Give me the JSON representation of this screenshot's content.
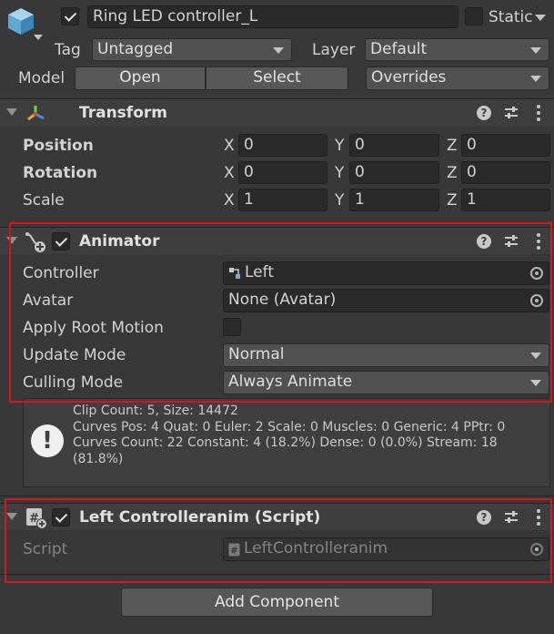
{
  "header": {
    "object_name": "Ring LED controller_L",
    "static_label": "Static",
    "tag_label": "Tag",
    "tag_value": "Untagged",
    "layer_label": "Layer",
    "layer_value": "Default",
    "model_label": "Model",
    "open_label": "Open",
    "select_label": "Select",
    "overrides_label": "Overrides"
  },
  "transform": {
    "title": "Transform",
    "position_label": "Position",
    "rotation_label": "Rotation",
    "scale_label": "Scale",
    "axes": [
      "X",
      "Y",
      "Z"
    ],
    "position": [
      "0",
      "0",
      "0"
    ],
    "rotation": [
      "0",
      "0",
      "0"
    ],
    "scale": [
      "1",
      "1",
      "1"
    ]
  },
  "animator": {
    "title": "Animator",
    "controller_label": "Controller",
    "controller_value": "Left",
    "avatar_label": "Avatar",
    "avatar_value": "None (Avatar)",
    "apply_root_motion_label": "Apply Root Motion",
    "update_mode_label": "Update Mode",
    "update_mode_value": "Normal",
    "culling_mode_label": "Culling Mode",
    "culling_mode_value": "Always Animate",
    "info_lines": [
      "Clip Count: 5, Size: 14472",
      "Curves Pos: 4 Quat: 0 Euler: 2 Scale: 0 Muscles: 0 Generic: 4 PPtr: 0",
      "Curves Count: 22 Constant: 4 (18.2%) Dense: 0 (0.0%) Stream: 18",
      "(81.8%)"
    ]
  },
  "script_component": {
    "title": "Left Controlleranim (Script)",
    "script_label": "Script",
    "script_value": "LeftControlleranim"
  },
  "add_component_label": "Add Component",
  "help_glyph": "?",
  "alert_glyph": "!",
  "colors": {
    "highlight_border": "#d6161d",
    "background": "#383838"
  },
  "icons": {
    "gameobject": "cube-icon",
    "transform": "transform-axes-icon",
    "animator": "animator-icon",
    "script": "script-icon"
  }
}
